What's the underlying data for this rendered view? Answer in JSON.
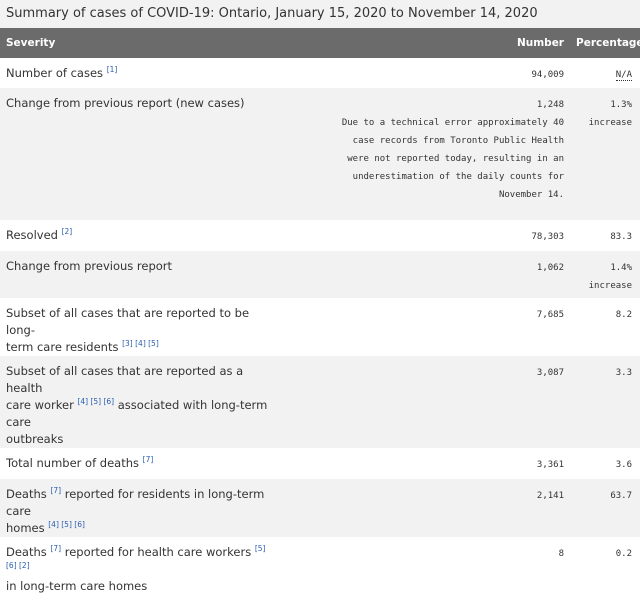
{
  "caption": "Summary of cases of COVID-19: Ontario, January 15, 2020 to November 14, 2020",
  "headers": {
    "severity": "Severity",
    "number": "Number",
    "percentage": "Percentage"
  },
  "rows": [
    {
      "label": "Number of cases",
      "refs": "[1]",
      "number": "94,009",
      "pct": "N/A"
    },
    {
      "label": "Change from previous report (new cases)",
      "number": "1,248",
      "pct": "1.3%",
      "pct_note": "increase",
      "note_lines": [
        "Due to a technical error approximately 40",
        "case records from Toronto Public Health",
        "were not reported today, resulting in an",
        "underestimation of the daily counts for",
        "November 14."
      ]
    },
    {
      "label": "Resolved",
      "refs": "[2]",
      "number": "78,303",
      "pct": "83.3"
    },
    {
      "label": "Change from previous report",
      "number": "1,062",
      "pct": "1.4%",
      "pct_note": "increase"
    },
    {
      "label_line1": "Subset of all cases that are reported to be long-",
      "label_line2": "term care residents",
      "refs": "[3] [4] [5]",
      "number": "7,685",
      "pct": "8.2"
    },
    {
      "label_line1": "Subset of all cases that are reported as a health",
      "label_line2a": "care worker",
      "refs": "[4] [5] [6]",
      "label_line2b": " associated with long-term care",
      "label_line3": "outbreaks",
      "number": "3,087",
      "pct": "3.3"
    },
    {
      "label": "Total number of deaths",
      "refs": "[7]",
      "number": "3,361",
      "pct": "3.6"
    },
    {
      "label_a": "Deaths",
      "refs_a": "[7]",
      "label_b": " reported for residents in long-term care",
      "label_line2": "homes",
      "refs_b": "[4] [5] [6]",
      "number": "2,141",
      "pct": "63.7"
    },
    {
      "label_a": "Deaths",
      "refs_a": "[7]",
      "label_b": " reported for health care workers",
      "refs_b": "[5] [6] [2]",
      "label_line2": "in long-term care homes",
      "number": "8",
      "pct": "0.2"
    }
  ]
}
